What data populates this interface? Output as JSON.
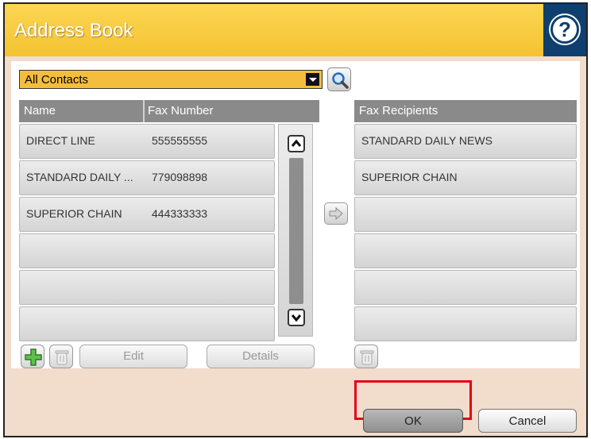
{
  "window": {
    "title": "Address Book",
    "help_icon": "question-mark-icon"
  },
  "filter": {
    "selected": "All Contacts",
    "search_icon": "magnifier-icon"
  },
  "contacts": {
    "headers": {
      "name": "Name",
      "fax": "Fax Number"
    },
    "rows": [
      {
        "name": "DIRECT LINE",
        "fax": "555555555"
      },
      {
        "name": "STANDARD DAILY ...",
        "fax": "779098898"
      },
      {
        "name": "SUPERIOR CHAIN",
        "fax": "444333333"
      },
      {
        "name": "",
        "fax": ""
      },
      {
        "name": "",
        "fax": ""
      },
      {
        "name": "",
        "fax": ""
      }
    ]
  },
  "recipients": {
    "header": "Fax Recipients",
    "rows": [
      "STANDARD DAILY NEWS",
      "SUPERIOR CHAIN",
      "",
      "",
      "",
      ""
    ]
  },
  "actions": {
    "edit": "Edit",
    "details": "Details"
  },
  "footer": {
    "ok": "OK",
    "cancel": "Cancel"
  },
  "colors": {
    "header": "#f4c232",
    "help_bg": "#0f3f6e",
    "dropdown": "#f4bd3c",
    "highlight": "#e2001a"
  }
}
